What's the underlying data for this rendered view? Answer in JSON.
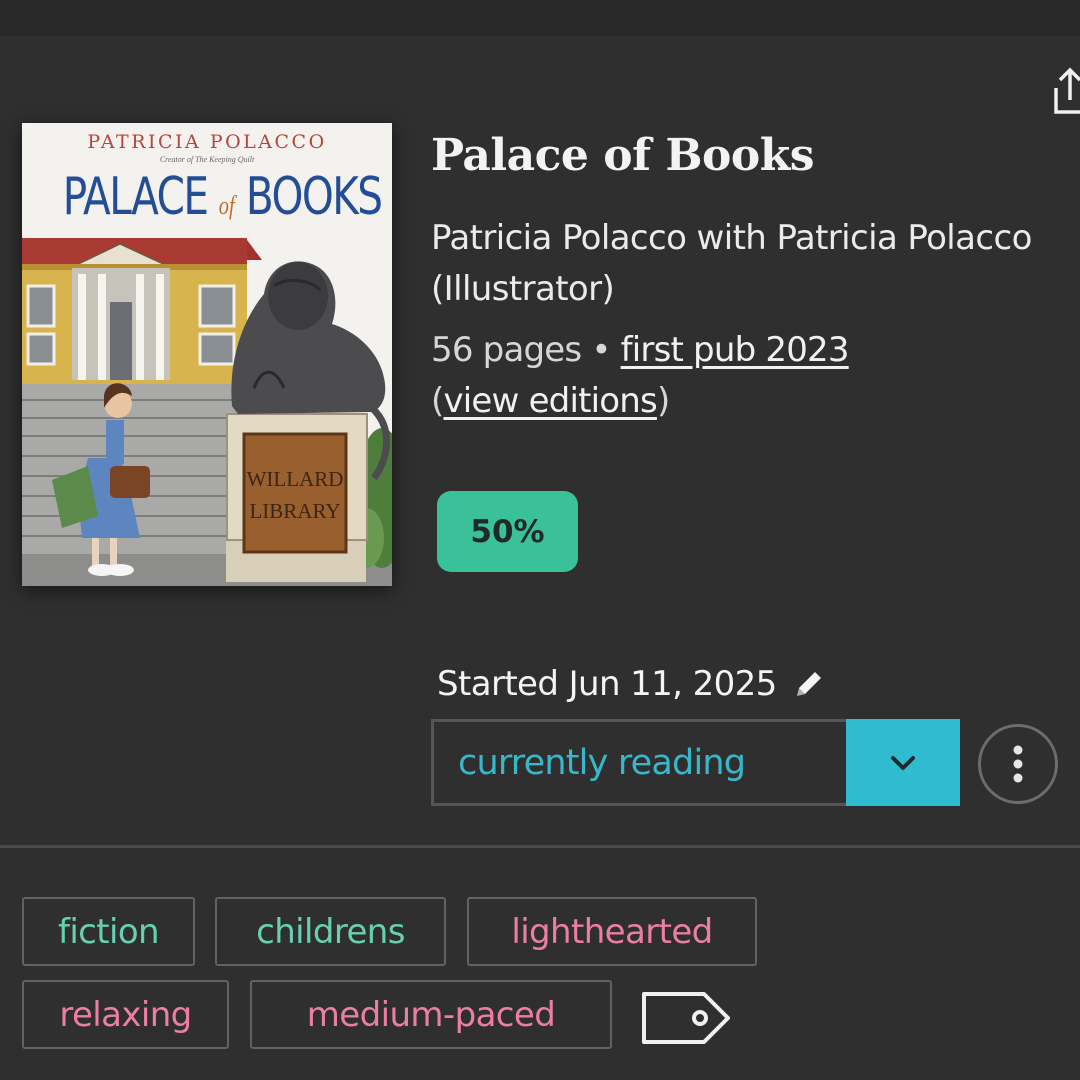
{
  "book": {
    "title": "Palace of Books",
    "contributors": "Patricia Polacco with Patricia Polacco (Illustrator)",
    "pages": "56 pages",
    "separator": "•",
    "first_pub": "first pub 2023",
    "view_editions": "view editions",
    "cover": {
      "author": "PATRICIA POLACCO",
      "tagline": "Creator of The Keeping Quilt",
      "title_part1": "PALACE",
      "title_of": "of",
      "title_part2": "BOOKS",
      "plaque_line1": "WILLARD",
      "plaque_line2": "LIBRARY"
    }
  },
  "progress": {
    "label": "50%",
    "value": 0.5
  },
  "reading": {
    "started_label": "Started Jun 11, 2025",
    "status": "currently reading"
  },
  "tags": {
    "genre": [
      "fiction",
      "childrens"
    ],
    "mood": [
      "lighthearted",
      "relaxing",
      "medium-paced"
    ]
  },
  "icons": {
    "share": "share-icon",
    "edit": "pencil-icon",
    "dropdown": "chevron-down-icon",
    "more": "vertical-dots-icon",
    "add_tag": "tag-icon"
  },
  "colors": {
    "background": "#2f2f2f",
    "progress_badge": "#3bc19a",
    "status_accent": "#30bcd0",
    "genre_tag": "#67d0b0",
    "mood_tag": "#ec7ea6"
  }
}
